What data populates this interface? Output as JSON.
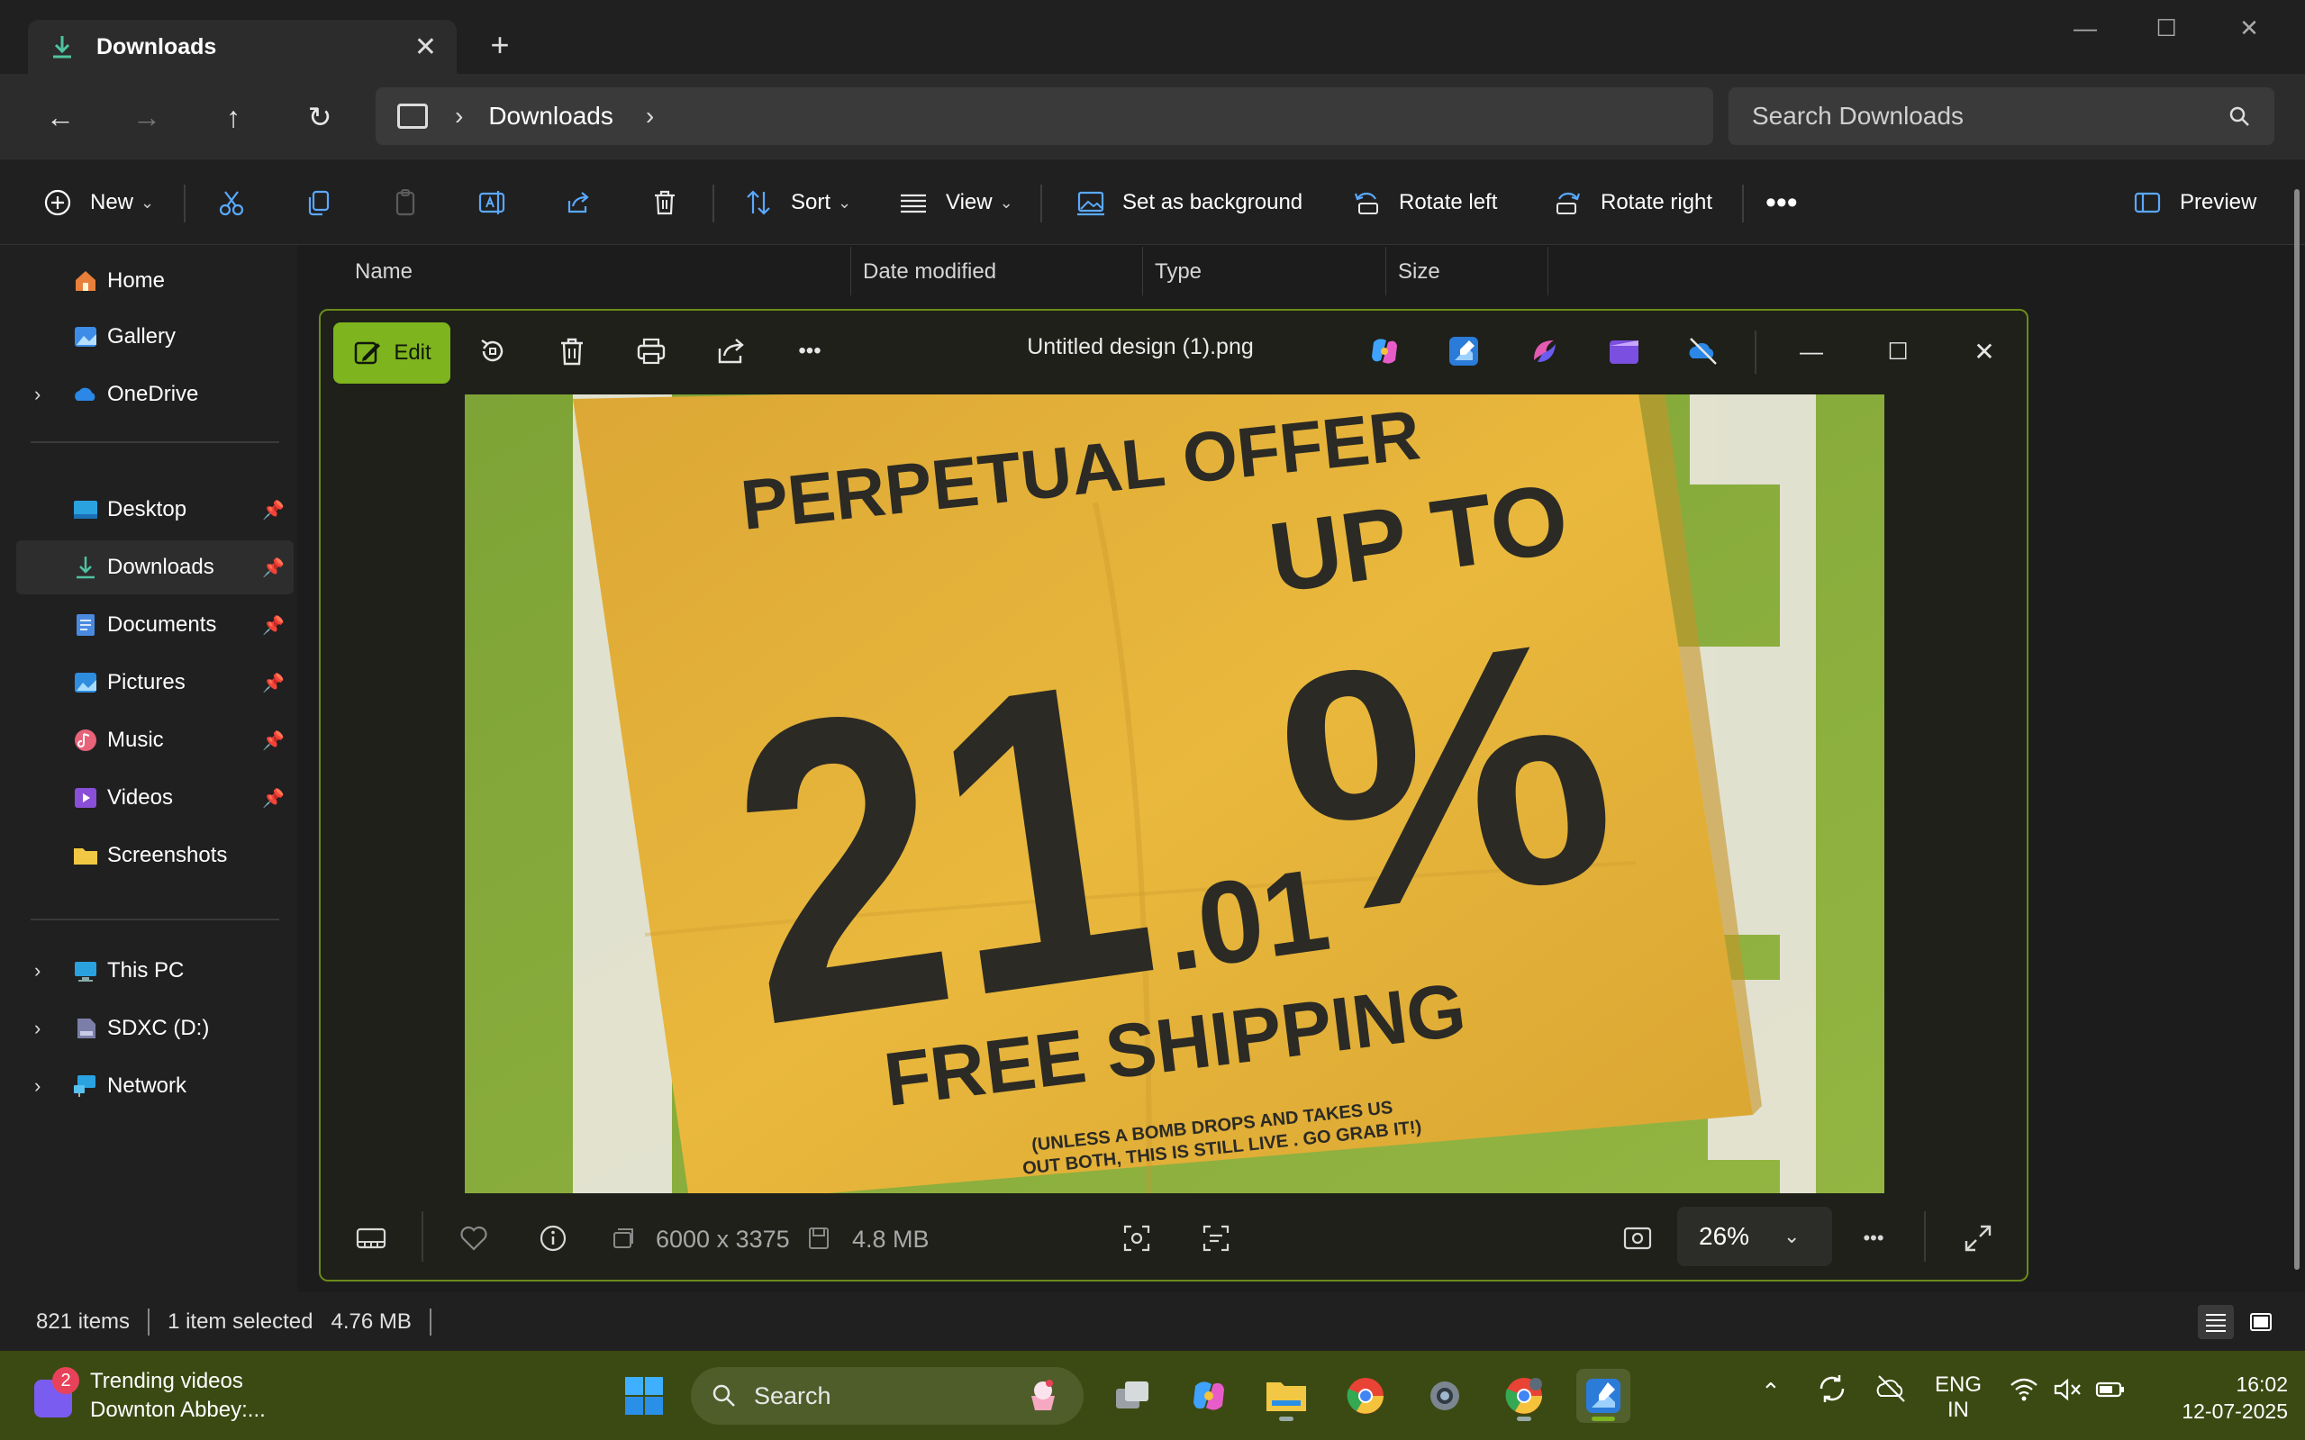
{
  "explorer": {
    "tab_title": "Downloads",
    "address": {
      "crumbs": [
        "Downloads"
      ]
    },
    "search_placeholder": "Search Downloads",
    "toolbar": {
      "new_label": "New",
      "sort_label": "Sort",
      "view_label": "View",
      "set_bg_label": "Set as background",
      "rotate_left_label": "Rotate left",
      "rotate_right_label": "Rotate right",
      "preview_label": "Preview"
    },
    "nav": {
      "home": "Home",
      "gallery": "Gallery",
      "onedrive": "OneDrive",
      "desktop": "Desktop",
      "downloads": "Downloads",
      "documents": "Documents",
      "pictures": "Pictures",
      "music": "Music",
      "videos": "Videos",
      "screenshots": "Screenshots",
      "this_pc": "This PC",
      "sdxc": "SDXC (D:)",
      "network": "Network"
    },
    "columns": {
      "name": "Name",
      "date": "Date modified",
      "type": "Type",
      "size": "Size"
    },
    "status": {
      "items": "821 items",
      "selected": "1 item selected",
      "size": "4.76 MB"
    }
  },
  "photos": {
    "edit_label": "Edit",
    "title": "Untitled design (1).png",
    "dimensions": "6000 x 3375",
    "file_size": "4.8 MB",
    "zoom": "26%",
    "image": {
      "line1": "PERPETUAL OFFER",
      "line2": "UP TO",
      "big_number": "21",
      "decimal": ".01",
      "percent": "%",
      "line3": "FREE SHIPPING",
      "fine1": "(UNLESS A BOMB DROPS  AND TAKES US",
      "fine2": "OUT BOTH, THIS IS STILL LIVE . GO GRAB IT!)"
    }
  },
  "taskbar": {
    "widget_badge": "2",
    "widget_title": "Trending videos",
    "widget_subtitle": "Downton Abbey:...",
    "search_label": "Search",
    "lang_top": "ENG",
    "lang_bottom": "IN",
    "time": "16:02",
    "date": "12-07-2025"
  },
  "colors": {
    "accent_green": "#7eb41d",
    "poster_yellow": "#e4b035",
    "poster_bg_green": "#86a83a",
    "taskbar": "#3b4a12"
  }
}
